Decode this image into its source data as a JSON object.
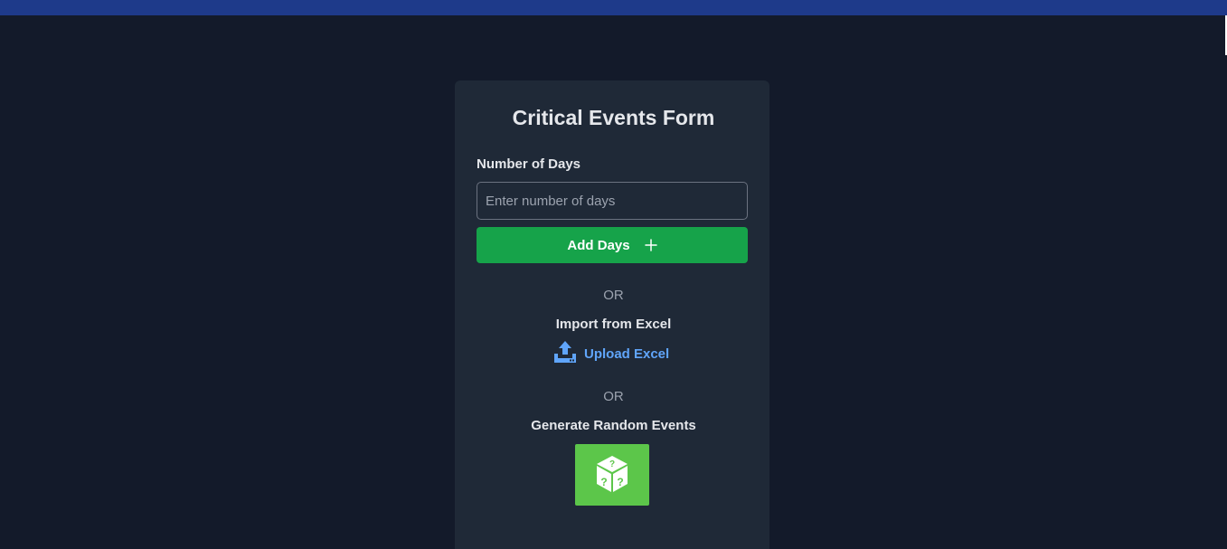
{
  "form": {
    "title": "Critical Events Form",
    "days_label": "Number of Days",
    "days_value": "",
    "days_placeholder": "Enter number of days",
    "add_button_label": "Add Days",
    "add_button_icon": "plus-icon",
    "separator_1": "OR",
    "import_label": "Import from Excel",
    "upload_label": "Upload Excel",
    "upload_icon": "upload-icon",
    "separator_2": "OR",
    "random_label": "Generate Random Events",
    "random_icon": "dice-icon"
  },
  "colors": {
    "background": "#131a2a",
    "topbar": "#1e3a8a",
    "card": "#1f2937",
    "add_button": "#16a34a",
    "link": "#60a5fa",
    "dice_button": "#5cc64a"
  }
}
